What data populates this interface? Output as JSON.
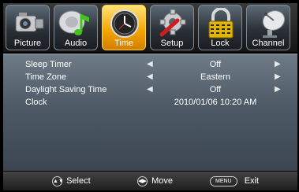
{
  "tabs": [
    {
      "label": "Picture",
      "icon": "camera-icon"
    },
    {
      "label": "Audio",
      "icon": "music-note-icon"
    },
    {
      "label": "Time",
      "icon": "clock-icon"
    },
    {
      "label": "Setup",
      "icon": "wrench-gear-icon"
    },
    {
      "label": "Lock",
      "icon": "padlock-icon"
    },
    {
      "label": "Channel",
      "icon": "satellite-dish-icon"
    }
  ],
  "active_tab": "Time",
  "menu": [
    {
      "name": "Sleep Timer",
      "value": "Off"
    },
    {
      "name": "Time Zone",
      "value": "Eastern"
    },
    {
      "name": "Daylight Saving Time",
      "value": "Off"
    },
    {
      "name": "Clock",
      "value": "2010/01/06 10:20 AM"
    }
  ],
  "arrows": {
    "left": "◀",
    "right": "▶"
  },
  "help": {
    "select_keys": "▲▼",
    "select_label": "Select",
    "move_keys": "◀▶",
    "move_label": "Move",
    "menu_key": "MENU",
    "exit_label": "Exit"
  },
  "colors": {
    "active_tab": "#f5a800",
    "panel": "#4d5965"
  }
}
